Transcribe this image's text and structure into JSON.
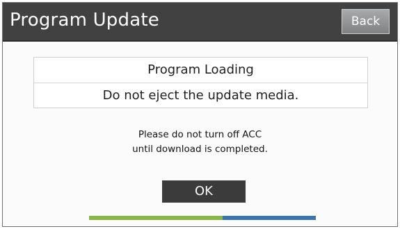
{
  "header": {
    "title": "Program Update",
    "back_label": "Back"
  },
  "message": {
    "status": "Program Loading",
    "warning": "Do not eject the update media."
  },
  "notice": {
    "line1": "Please do not turn off ACC",
    "line2": "until download is completed."
  },
  "ok_label": "OK",
  "progress": {
    "fraction": 0.59
  },
  "colors": {
    "header_bg": "#414141",
    "progress_fill": "#8ab547",
    "progress_track": "#3d74ad",
    "button_bg": "#3b3b3b"
  }
}
